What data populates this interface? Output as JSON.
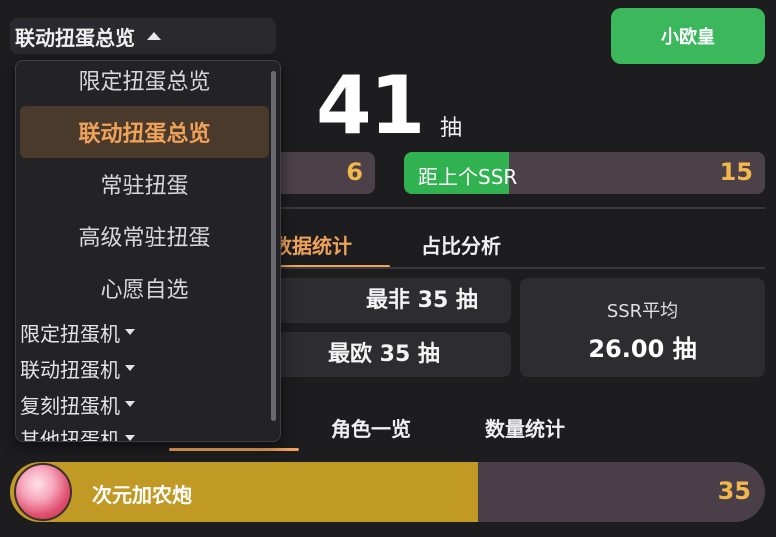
{
  "header": {
    "pool_selector_label": "联动扭蛋总览",
    "title_button": "小欧皇"
  },
  "summary": {
    "total_pulls": "41",
    "unit": "抽",
    "pity_left_value": "6",
    "pity_right_label": "距上个SSR",
    "pity_right_value": "15",
    "pity_right_fill_fraction": 0.29
  },
  "tabs_top": [
    {
      "label": "数据统计",
      "active": true
    },
    {
      "label": "占比分析",
      "active": false
    }
  ],
  "stats": {
    "worst": "最非 35 抽",
    "best": "最欧 35 抽",
    "ssr_avg_label": "SSR平均",
    "ssr_avg_value": "26.00 抽"
  },
  "tabs_bottom": [
    {
      "label": "角色一览",
      "active": false
    },
    {
      "label": "数量统计",
      "active": false
    }
  ],
  "characters": [
    {
      "name": "次元加农炮",
      "count": "35",
      "fill_fraction": 0.62
    }
  ],
  "menu": {
    "items": [
      {
        "label": "限定扭蛋总览",
        "selected": false
      },
      {
        "label": "联动扭蛋总览",
        "selected": true
      },
      {
        "label": "常驻扭蛋",
        "selected": false
      },
      {
        "label": "高级常驻扭蛋",
        "selected": false
      },
      {
        "label": "心愿自选",
        "selected": false
      }
    ],
    "groups": [
      {
        "label": "限定扭蛋机"
      },
      {
        "label": "联动扭蛋机"
      },
      {
        "label": "复刻扭蛋机"
      },
      {
        "label": "其他扭蛋机"
      }
    ]
  },
  "colors": {
    "accent_orange": "#eea25a",
    "green": "#3bb85c",
    "gold": "#c19a26",
    "value_gold": "#f2b84b"
  }
}
